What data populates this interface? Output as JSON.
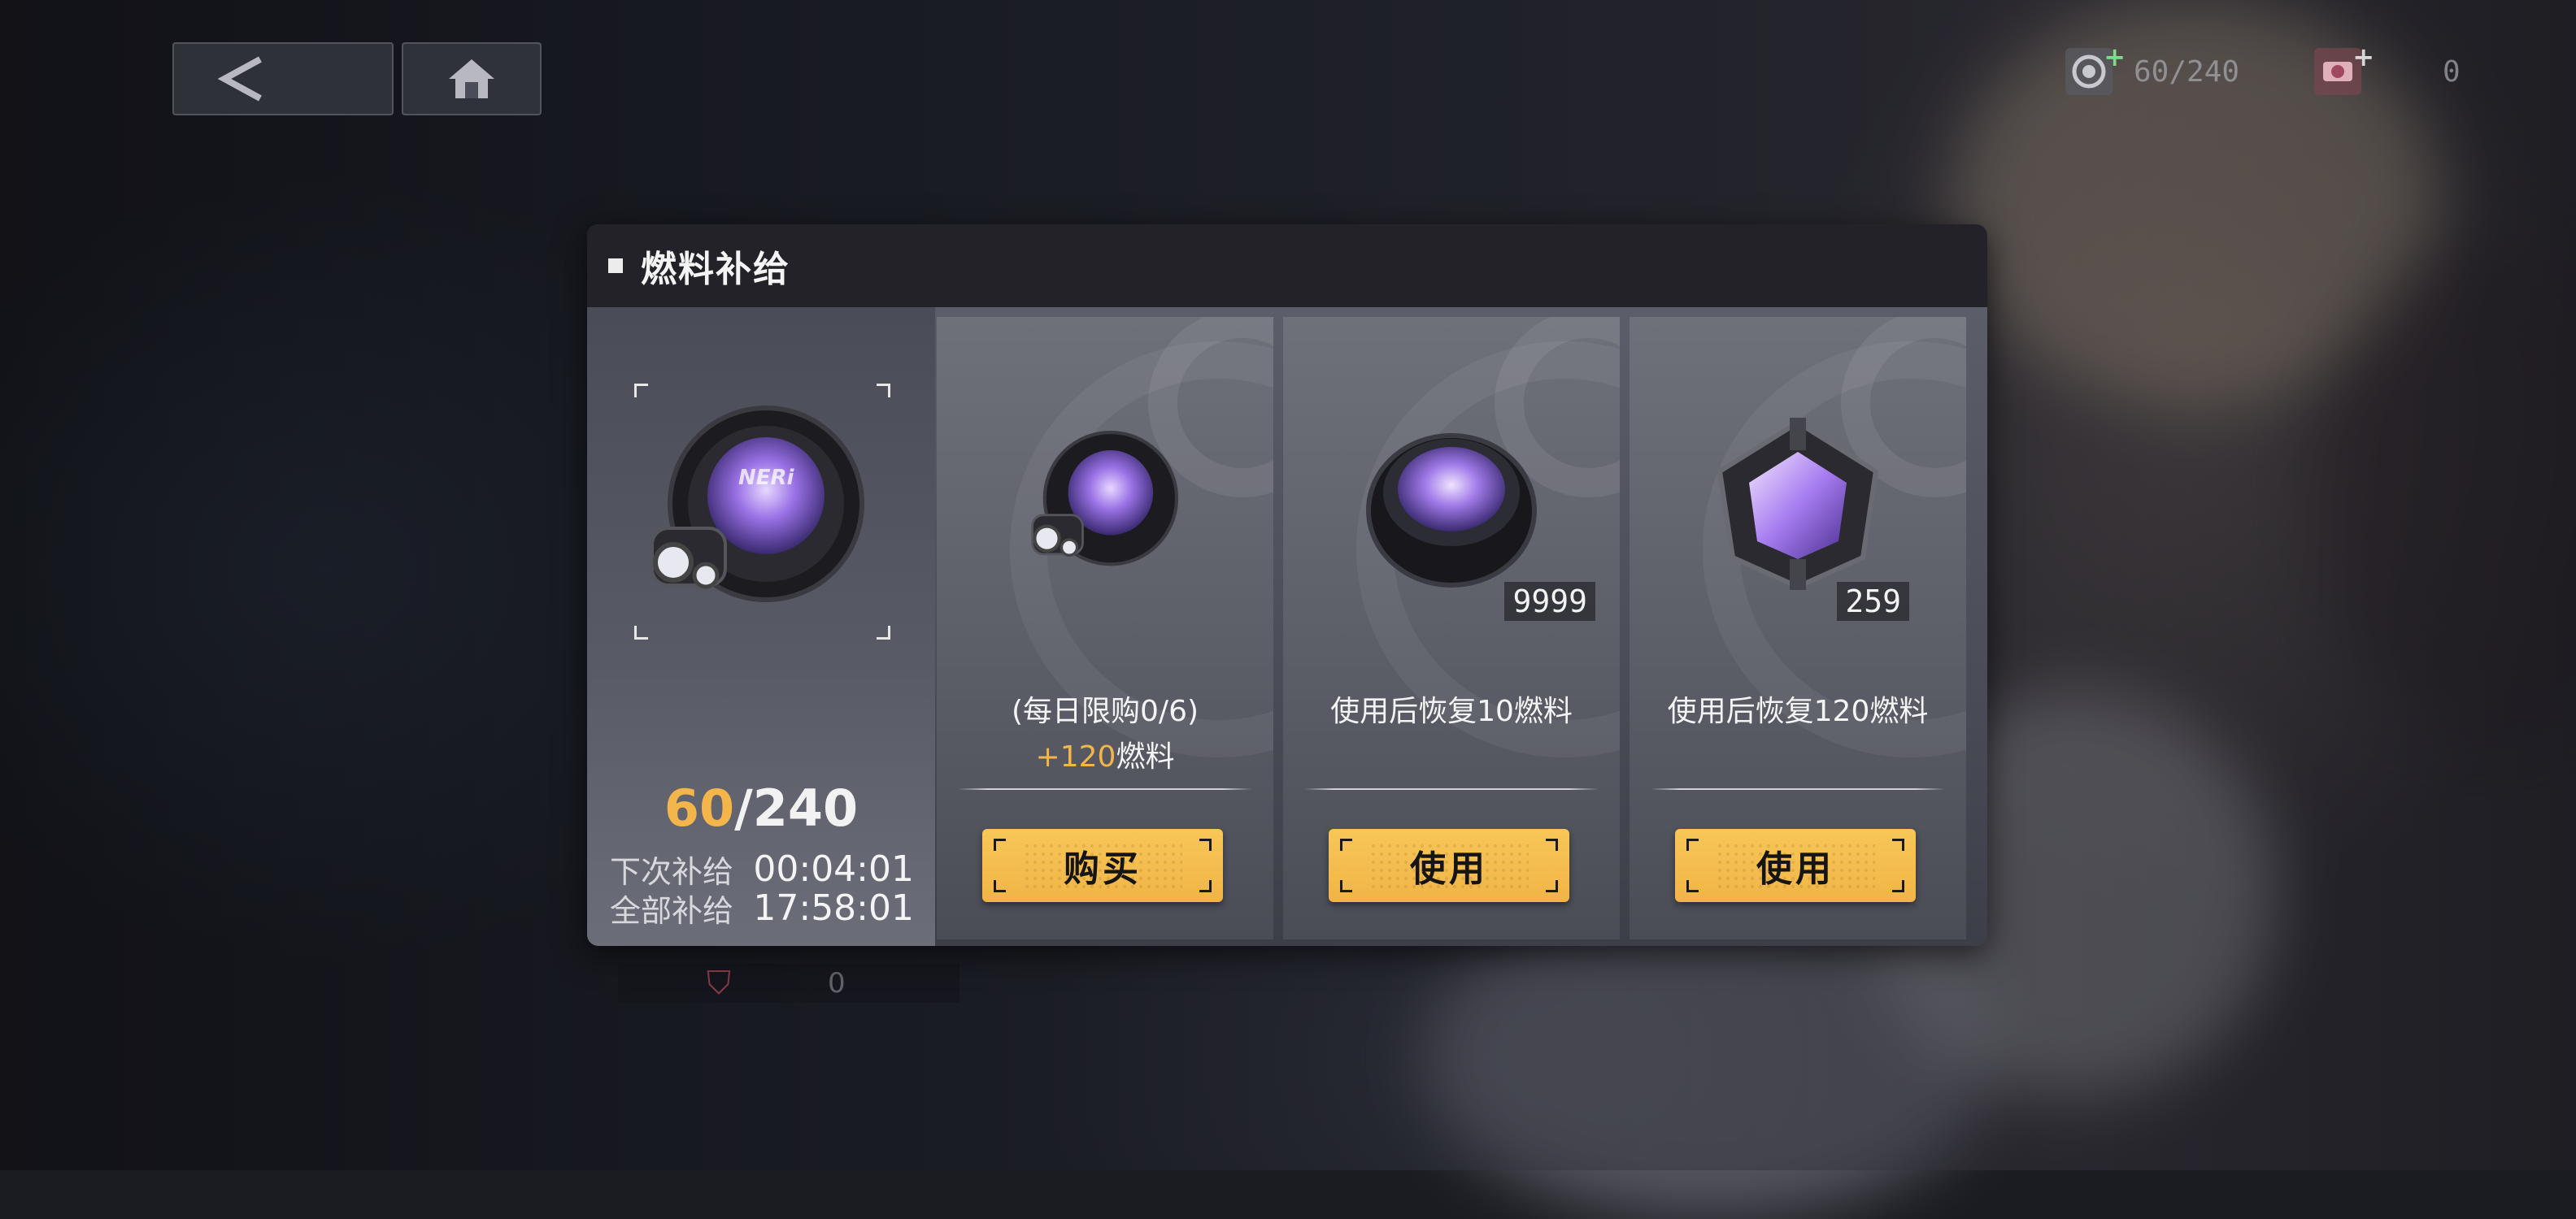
{
  "dialog": {
    "title": "燃料补给",
    "fuel": {
      "current": "60",
      "separator": "/",
      "max": "240"
    },
    "next_supply": {
      "label": "下次补给",
      "value": "00:04:01"
    },
    "full_supply": {
      "label": "全部补给",
      "value": "17:58:01"
    },
    "cards": [
      {
        "desc_line1": "(每日限购0/6)",
        "bonus": "+120",
        "bonus_unit": "燃料",
        "quantity": "",
        "button": "购买"
      },
      {
        "desc_line1": "使用后恢复10燃料",
        "quantity": "9999",
        "button": "使用"
      },
      {
        "desc_line1": "使用后恢复120燃料",
        "quantity": "259",
        "button": "使用"
      }
    ]
  },
  "topbar": {
    "fuel_amount": "60/240",
    "gem_amount": "0",
    "back_icon": "back-arrow-icon",
    "home_icon": "home-icon"
  },
  "background": {
    "ghost_count": "0"
  },
  "colors": {
    "accent": "#f4b54a",
    "button": "#f1b446",
    "header": "#222228"
  },
  "brand_mark": "NERi"
}
